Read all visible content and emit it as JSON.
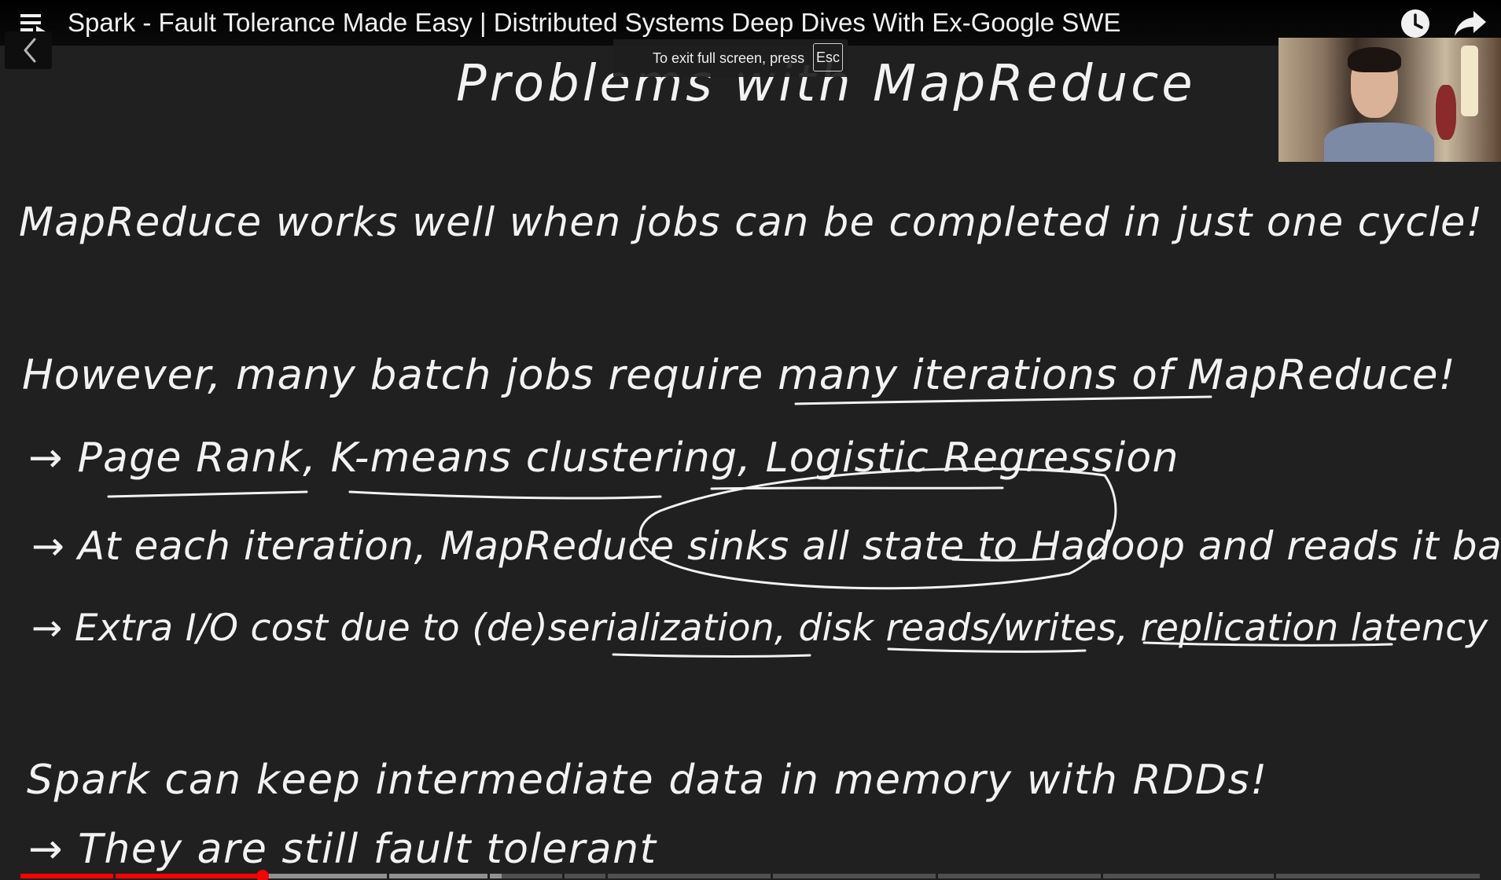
{
  "player": {
    "title": "Spark - Fault Tolerance Made Easy | Distributed Systems Deep Dives With Ex-Google SWE",
    "fullscreen_toast": {
      "text": "To exit full screen, press",
      "key": "Esc"
    },
    "icons": {
      "playlist": "playlist-icon",
      "watch_later": "clock-icon",
      "share": "share-arrow-icon",
      "back": "chevron-left-icon"
    },
    "progress": {
      "played_fraction": 0.166,
      "loaded_fraction": 0.33
    },
    "colors": {
      "accent": "#ff0000",
      "board": "#202020",
      "ink": "#f2f2f2"
    }
  },
  "slide": {
    "heading": "Problems with MapReduce",
    "line1": "MapReduce works well when jobs can be completed in just one cycle!",
    "line2": "However, many batch jobs require many iterations of MapReduce!",
    "bullet1": "→ Page Rank, K-means clustering, Logistic Regression",
    "bullet2": "→ At each iteration, MapReduce sinks all state to Hadoop and reads it back",
    "bullet3": "→ Extra I/O cost due to (de)serialization, disk reads/writes, replication latency",
    "line3": "Spark can keep intermediate data in memory with RDDs!",
    "bullet4": "→ They are still fault tolerant"
  }
}
